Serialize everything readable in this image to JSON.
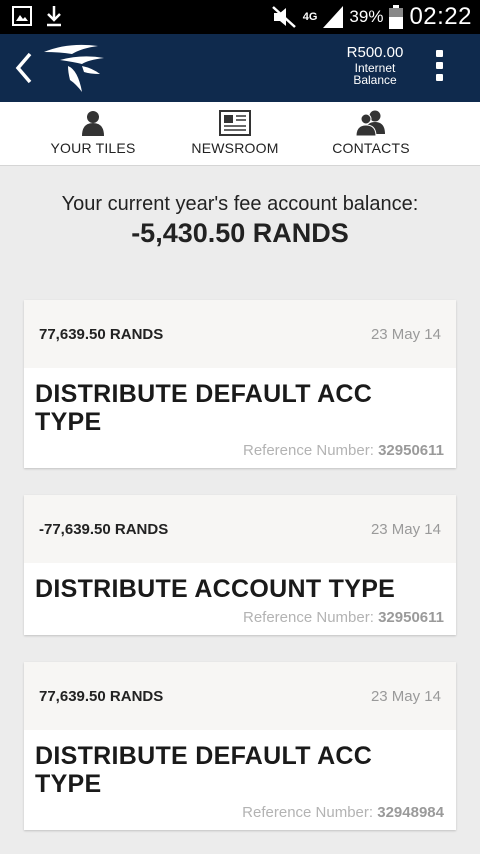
{
  "status_bar": {
    "network": "4G",
    "battery_percent": "39%",
    "time": "02:22",
    "icons": [
      "gallery-icon",
      "download-icon",
      "mute-icon",
      "signal-icon",
      "battery-icon"
    ]
  },
  "app_bar": {
    "balance_amount": "R500.00",
    "balance_label_line1": "Internet",
    "balance_label_line2": "Balance",
    "colors": {
      "bar": "#0f2a4d"
    }
  },
  "tabs": [
    {
      "label": "YOUR TILES",
      "icon": "person-icon"
    },
    {
      "label": "NEWSROOM",
      "icon": "newspaper-icon"
    },
    {
      "label": "CONTACTS",
      "icon": "contacts-icon"
    }
  ],
  "summary": {
    "label": "Your current year's fee account balance:",
    "value": "-5,430.50 RANDS"
  },
  "transactions": [
    {
      "amount": "77,639.50 RANDS",
      "date": "23 May 14",
      "title_line1": "DISTRIBUTE DEFAULT ACC",
      "title_line2": "TYPE",
      "ref_label": "Reference Number:",
      "ref_number": "32950611"
    },
    {
      "amount": "-77,639.50 RANDS",
      "date": "23 May 14",
      "title_line1": "DISTRIBUTE ACCOUNT TYPE",
      "title_line2": "",
      "ref_label": "Reference Number:",
      "ref_number": "32950611"
    },
    {
      "amount": "77,639.50 RANDS",
      "date": "23 May 14",
      "title_line1": "DISTRIBUTE DEFAULT ACC",
      "title_line2": "TYPE",
      "ref_label": "Reference Number:",
      "ref_number": "32948984"
    }
  ]
}
